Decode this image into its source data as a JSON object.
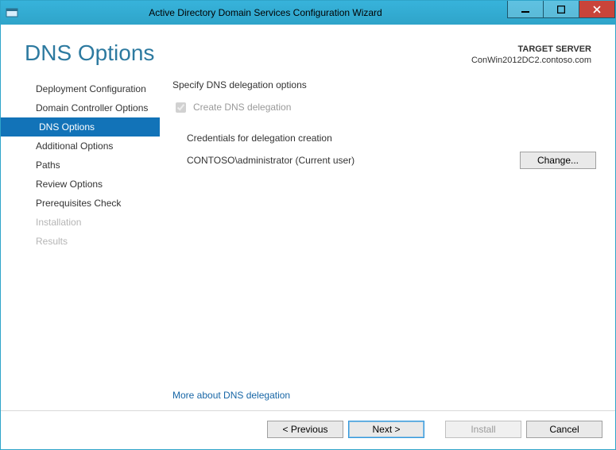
{
  "window": {
    "title": "Active Directory Domain Services Configuration Wizard"
  },
  "header": {
    "page_title": "DNS Options",
    "target_label": "TARGET SERVER",
    "target_value": "ConWin2012DC2.contoso.com"
  },
  "sidebar": {
    "items": [
      {
        "label": "Deployment Configuration",
        "selected": false,
        "disabled": false
      },
      {
        "label": "Domain Controller Options",
        "selected": false,
        "disabled": false
      },
      {
        "label": "DNS Options",
        "selected": true,
        "disabled": false
      },
      {
        "label": "Additional Options",
        "selected": false,
        "disabled": false
      },
      {
        "label": "Paths",
        "selected": false,
        "disabled": false
      },
      {
        "label": "Review Options",
        "selected": false,
        "disabled": false
      },
      {
        "label": "Prerequisites Check",
        "selected": false,
        "disabled": false
      },
      {
        "label": "Installation",
        "selected": false,
        "disabled": true
      },
      {
        "label": "Results",
        "selected": false,
        "disabled": true
      }
    ]
  },
  "content": {
    "section_title": "Specify DNS delegation options",
    "checkbox_label": "Create DNS delegation",
    "checkbox_checked": true,
    "checkbox_disabled": true,
    "cred_heading": "Credentials for delegation creation",
    "cred_user": "CONTOSO\\administrator (Current user)",
    "change_button": "Change...",
    "more_link": "More about DNS delegation"
  },
  "footer": {
    "previous": "< Previous",
    "next": "Next >",
    "install": "Install",
    "cancel": "Cancel",
    "install_disabled": true
  }
}
